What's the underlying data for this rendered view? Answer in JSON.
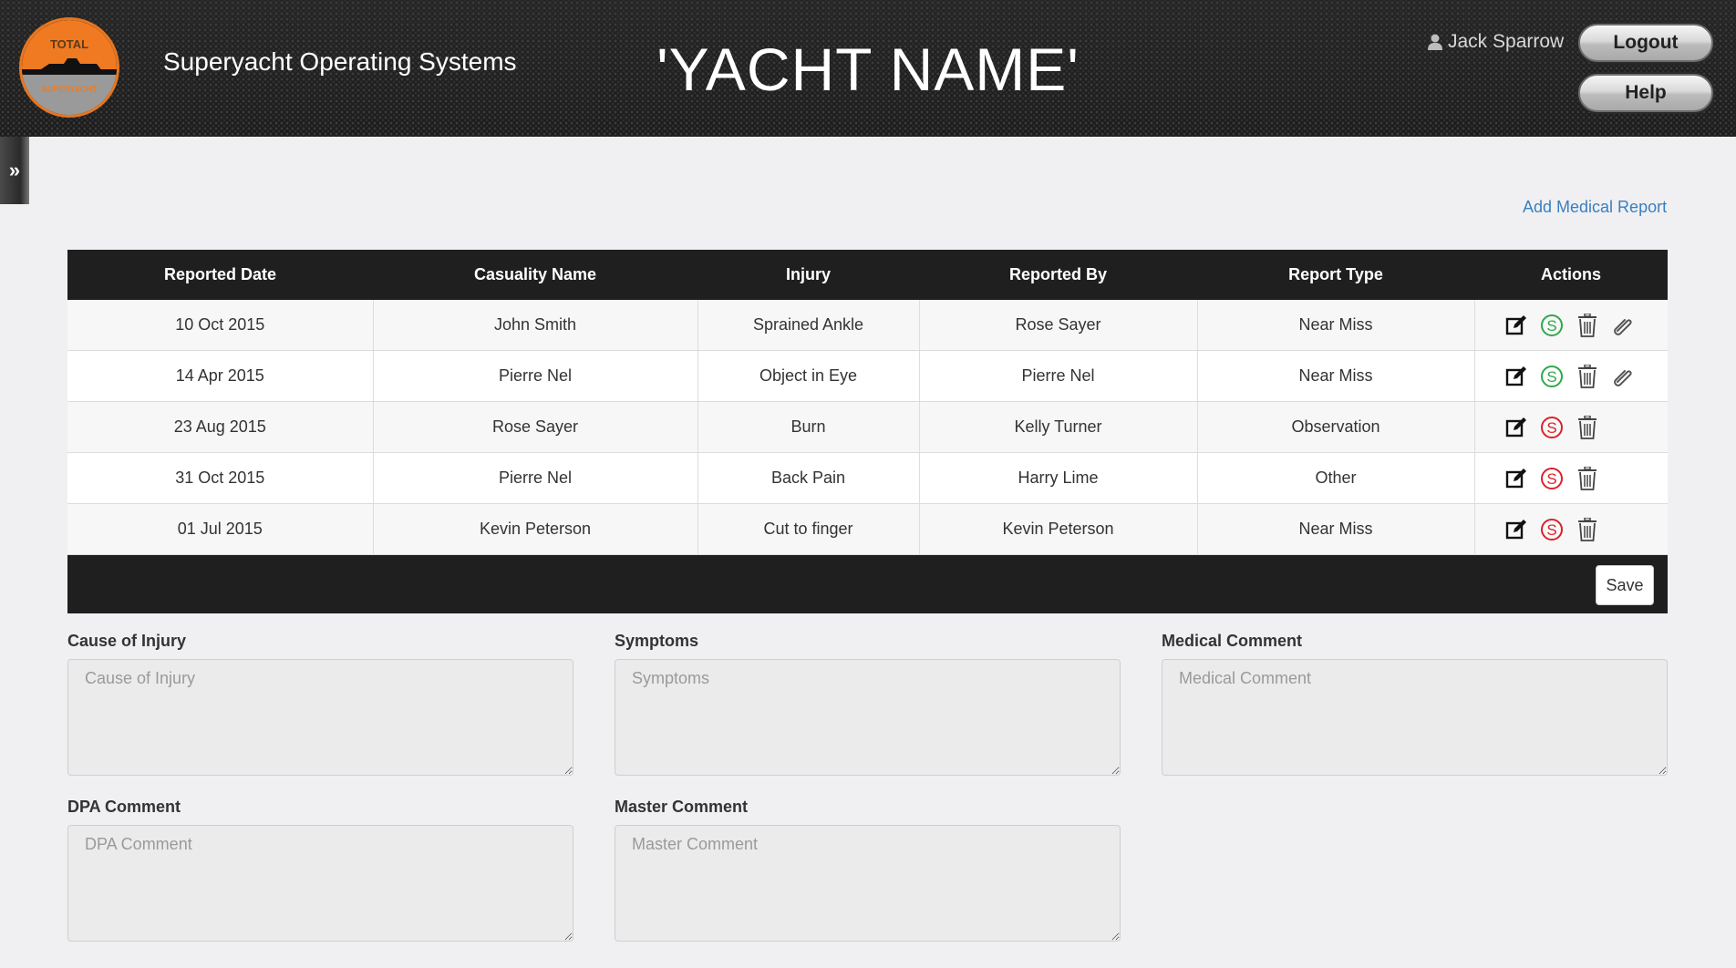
{
  "header": {
    "logo_top_text": "TOTAL",
    "logo_bottom_text": "SUPERYACHT",
    "app_title": "Superyacht Operating Systems",
    "yacht_name": "'YACHT NAME'",
    "user_name": "Jack Sparrow",
    "logout_label": "Logout",
    "help_label": "Help"
  },
  "sidebar_toggle": {
    "glyph": "»"
  },
  "add_link": "Add Medical Report",
  "table": {
    "columns": [
      "Reported Date",
      "Casuality Name",
      "Injury",
      "Reported By",
      "Report Type",
      "Actions"
    ],
    "rows": [
      {
        "date": "10 Oct 2015",
        "name": "John Smith",
        "injury": "Sprained Ankle",
        "by": "Rose Sayer",
        "type": "Near Miss",
        "signed": true,
        "attachment": true
      },
      {
        "date": "14 Apr 2015",
        "name": "Pierre Nel",
        "injury": "Object in Eye",
        "by": "Pierre Nel",
        "type": "Near Miss",
        "signed": true,
        "attachment": true
      },
      {
        "date": "23 Aug 2015",
        "name": "Rose Sayer",
        "injury": "Burn",
        "by": "Kelly Turner",
        "type": "Observation",
        "signed": false,
        "attachment": false
      },
      {
        "date": "31 Oct 2015",
        "name": "Pierre Nel",
        "injury": "Back Pain",
        "by": "Harry Lime",
        "type": "Other",
        "signed": false,
        "attachment": false
      },
      {
        "date": "01 Jul 2015",
        "name": "Kevin Peterson",
        "injury": "Cut to finger",
        "by": "Kevin Peterson",
        "type": "Near Miss",
        "signed": false,
        "attachment": false
      }
    ],
    "save_label": "Save"
  },
  "form": {
    "cause": {
      "label": "Cause of Injury",
      "placeholder": "Cause of Injury"
    },
    "symptoms": {
      "label": "Symptoms",
      "placeholder": "Symptoms"
    },
    "medical": {
      "label": "Medical Comment",
      "placeholder": "Medical Comment"
    },
    "dpa": {
      "label": "DPA Comment",
      "placeholder": "DPA Comment"
    },
    "master": {
      "label": "Master Comment",
      "placeholder": "Master Comment"
    }
  },
  "colors": {
    "accent_orange": "#e8761f",
    "link_blue": "#3a7fc1",
    "signed_green": "#2ea84a",
    "unsigned_red": "#d9232a",
    "header_dark": "#1f1f1f"
  },
  "icons": {
    "edit": "edit-icon",
    "sign": "sign-icon",
    "delete": "trash-icon",
    "attach": "paperclip-icon",
    "user": "user-icon"
  }
}
